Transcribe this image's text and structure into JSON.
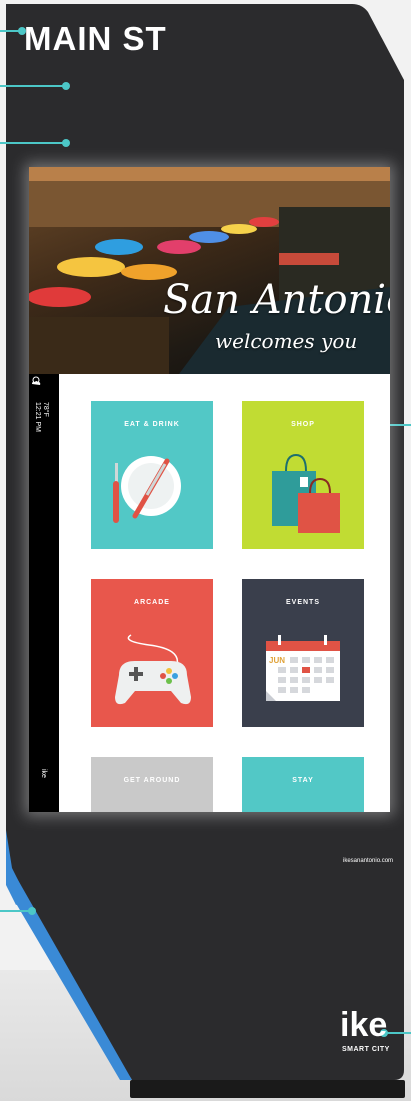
{
  "kiosk": {
    "location_title": "MAIN ST",
    "body_color": "#2b2b2d",
    "accent_color": "#3a8ad6",
    "callout_color": "#4cc7c7"
  },
  "hero": {
    "headline": "San Antonio",
    "subline": "welcomes you"
  },
  "status": {
    "temperature": "78°F",
    "time": "12:21 PM",
    "weather_icon": "cloud-sun-icon",
    "brand": "ike"
  },
  "tiles": [
    {
      "label": "EAT & DRINK",
      "color": "#52c8c6",
      "icon": "plate-utensils-icon"
    },
    {
      "label": "SHOP",
      "color": "#c1dc33",
      "icon": "shopping-bags-icon"
    },
    {
      "label": "ARCADE",
      "color": "#e8574c",
      "icon": "game-controller-icon"
    },
    {
      "label": "EVENTS",
      "color": "#3a3f4c",
      "icon": "calendar-icon"
    },
    {
      "label": "GET AROUND",
      "color": "#c9c9c9",
      "icon": "map-icon"
    },
    {
      "label": "STAY",
      "color": "#52c8c6",
      "icon": "hotel-icon"
    }
  ],
  "calendar": {
    "month": "JUN"
  },
  "footer": {
    "url": "ikesanantonio.com",
    "logo": "ike",
    "logo_sub": "SMART CITY"
  }
}
